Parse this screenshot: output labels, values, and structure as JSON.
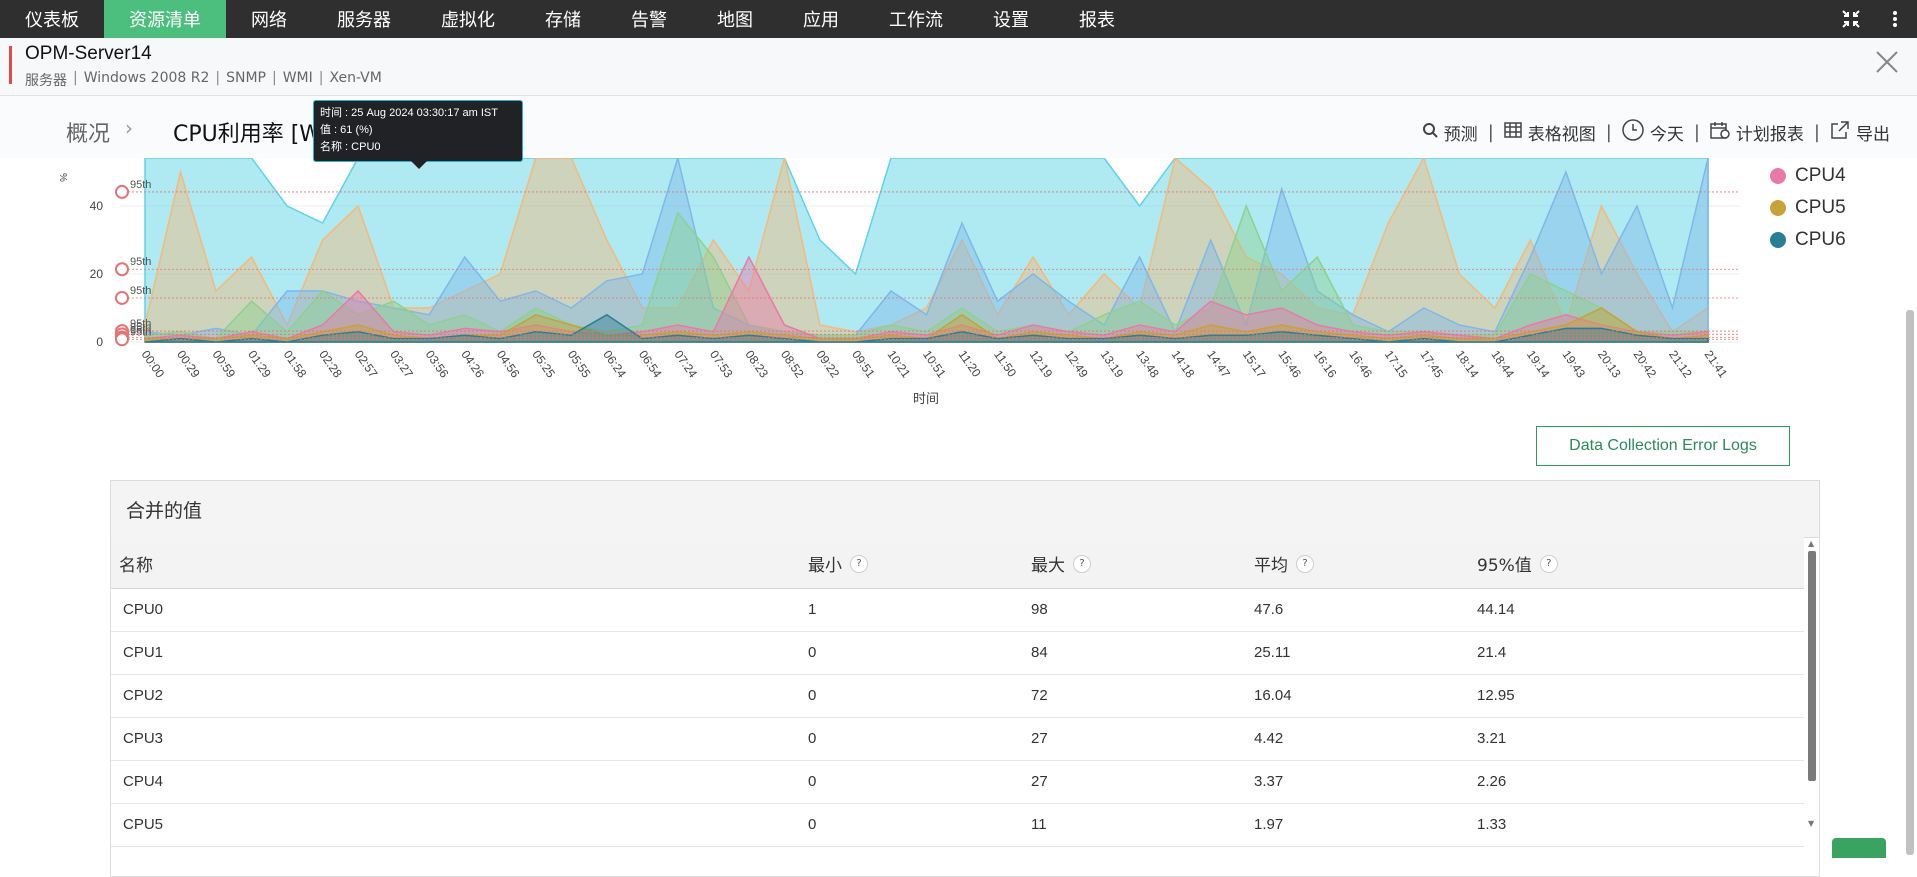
{
  "nav": {
    "items": [
      "仪表板",
      "资源清单",
      "网络",
      "服务器",
      "虚拟化",
      "存储",
      "告警",
      "地图",
      "应用",
      "工作流",
      "设置",
      "报表"
    ],
    "active_index": 1,
    "active_color": "#4cbf7e",
    "right_icons": [
      "collapse-icon",
      "more-icon"
    ]
  },
  "device": {
    "name": "OPM-Server14",
    "meta": [
      "服务器",
      "Windows 2008 R2",
      "SNMP",
      "WMI",
      "Xen-VM"
    ],
    "close_icon": "close-icon"
  },
  "breadcrumb": {
    "home": "概况",
    "title": "CPU利用率 [W"
  },
  "actions": [
    {
      "label": "预测",
      "icon": "forecast-icon"
    },
    {
      "label": "表格视图",
      "icon": "table-icon"
    },
    {
      "label": "今天",
      "icon": "clock-icon"
    },
    {
      "label": "计划报表",
      "icon": "calendar-icon"
    },
    {
      "label": "导出",
      "icon": "export-icon"
    }
  ],
  "tooltip": {
    "time": "时间 : 25 Aug 2024 03:30:17 am IST",
    "value": "值 : 61 (%)",
    "name": "名称 : CPU0"
  },
  "chart_data": {
    "type": "area",
    "title": "",
    "xlabel": "时间",
    "ylabel": "%",
    "y_ticks": [
      0,
      20,
      40
    ],
    "ylim": [
      0,
      100
    ],
    "x": [
      "00:00",
      "00:29",
      "00:59",
      "01:29",
      "01:58",
      "02:28",
      "02:57",
      "03:27",
      "03:56",
      "04:26",
      "04:56",
      "05:25",
      "05:55",
      "06:24",
      "06:54",
      "07:24",
      "07:53",
      "08:23",
      "08:52",
      "09:22",
      "09:51",
      "10:21",
      "10:51",
      "11:20",
      "11:50",
      "12:19",
      "12:49",
      "13:19",
      "13:48",
      "14:18",
      "14:47",
      "15:17",
      "15:46",
      "16:16",
      "16:46",
      "17:15",
      "17:45",
      "18:14",
      "18:44",
      "19:14",
      "19:43",
      "20:13",
      "20:42",
      "21:12",
      "21:41"
    ],
    "percentile_label": "95th",
    "legend_visible": [
      "CPU4",
      "CPU5",
      "CPU6"
    ],
    "series": [
      {
        "name": "CPU0",
        "color": "#5fd3e6",
        "percentile95": 44.14,
        "values": [
          60,
          70,
          75,
          80,
          40,
          35,
          85,
          61,
          65,
          90,
          55,
          80,
          70,
          60,
          90,
          85,
          75,
          90,
          80,
          30,
          20,
          60,
          80,
          90,
          70,
          80,
          90,
          75,
          40,
          60,
          90,
          65,
          80,
          85,
          70,
          60,
          90,
          85,
          80,
          55,
          85,
          80,
          75,
          65,
          80
        ]
      },
      {
        "name": "CPU1",
        "color": "#f5b97a",
        "percentile95": 21.4,
        "values": [
          5,
          50,
          15,
          25,
          5,
          30,
          40,
          10,
          10,
          15,
          20,
          60,
          80,
          30,
          10,
          10,
          30,
          15,
          60,
          5,
          3,
          5,
          10,
          30,
          8,
          25,
          8,
          20,
          10,
          55,
          45,
          25,
          20,
          10,
          8,
          35,
          80,
          20,
          10,
          30,
          5,
          40,
          20,
          3,
          10
        ]
      },
      {
        "name": "CPU2",
        "color": "#7fb8e8",
        "percentile95": 12.95,
        "values": [
          3,
          2,
          4,
          2,
          15,
          15,
          12,
          10,
          8,
          25,
          12,
          15,
          10,
          18,
          20,
          80,
          10,
          5,
          3,
          2,
          2,
          15,
          8,
          35,
          12,
          20,
          12,
          5,
          25,
          3,
          30,
          5,
          45,
          15,
          8,
          3,
          10,
          5,
          3,
          25,
          50,
          20,
          40,
          10,
          60
        ]
      },
      {
        "name": "CPU3",
        "color": "#8fd08f",
        "percentile95": 3.21,
        "values": [
          2,
          3,
          1,
          12,
          3,
          15,
          8,
          12,
          5,
          8,
          3,
          10,
          5,
          3,
          5,
          38,
          25,
          5,
          3,
          2,
          2,
          5,
          3,
          10,
          3,
          5,
          3,
          8,
          12,
          5,
          10,
          40,
          15,
          25,
          5,
          3,
          3,
          2,
          2,
          20,
          15,
          10,
          3,
          3,
          3
        ]
      },
      {
        "name": "CPU4",
        "color": "#e87aa8",
        "percentile95": 2.26,
        "values": [
          1,
          2,
          1,
          3,
          1,
          5,
          15,
          3,
          2,
          4,
          3,
          5,
          3,
          2,
          3,
          5,
          3,
          25,
          5,
          1,
          1,
          3,
          2,
          5,
          2,
          5,
          3,
          2,
          5,
          3,
          12,
          8,
          10,
          5,
          3,
          2,
          3,
          2,
          1,
          5,
          8,
          5,
          3,
          2,
          3
        ]
      },
      {
        "name": "CPU5",
        "color": "#c7a13a",
        "percentile95": 1.33,
        "values": [
          1,
          1,
          1,
          2,
          1,
          3,
          5,
          2,
          1,
          2,
          2,
          8,
          5,
          2,
          2,
          3,
          2,
          3,
          2,
          1,
          1,
          2,
          1,
          8,
          1,
          3,
          2,
          1,
          3,
          2,
          5,
          3,
          5,
          3,
          2,
          1,
          2,
          1,
          1,
          3,
          5,
          10,
          3,
          1,
          2
        ]
      },
      {
        "name": "CPU6",
        "color": "#2a7f96",
        "percentile95": 0.8,
        "values": [
          0,
          1,
          0,
          1,
          0,
          2,
          3,
          1,
          1,
          2,
          1,
          3,
          2,
          8,
          1,
          2,
          1,
          2,
          1,
          0,
          0,
          1,
          1,
          3,
          1,
          2,
          1,
          1,
          2,
          1,
          2,
          2,
          3,
          2,
          1,
          0,
          1,
          0,
          0,
          2,
          4,
          4,
          2,
          1,
          1
        ]
      }
    ]
  },
  "buttons": {
    "error_logs": "Data Collection Error Logs"
  },
  "table": {
    "title": "合并的值",
    "headers": [
      "名称",
      "最小",
      "最大",
      "平均",
      "95%值"
    ],
    "help_glyph": "?",
    "rows": [
      [
        "CPU0",
        "1",
        "98",
        "47.6",
        "44.14"
      ],
      [
        "CPU1",
        "0",
        "84",
        "25.11",
        "21.4"
      ],
      [
        "CPU2",
        "0",
        "72",
        "16.04",
        "12.95"
      ],
      [
        "CPU3",
        "0",
        "27",
        "4.42",
        "3.21"
      ],
      [
        "CPU4",
        "0",
        "27",
        "3.37",
        "2.26"
      ],
      [
        "CPU5",
        "0",
        "11",
        "1.97",
        "1.33"
      ]
    ]
  }
}
